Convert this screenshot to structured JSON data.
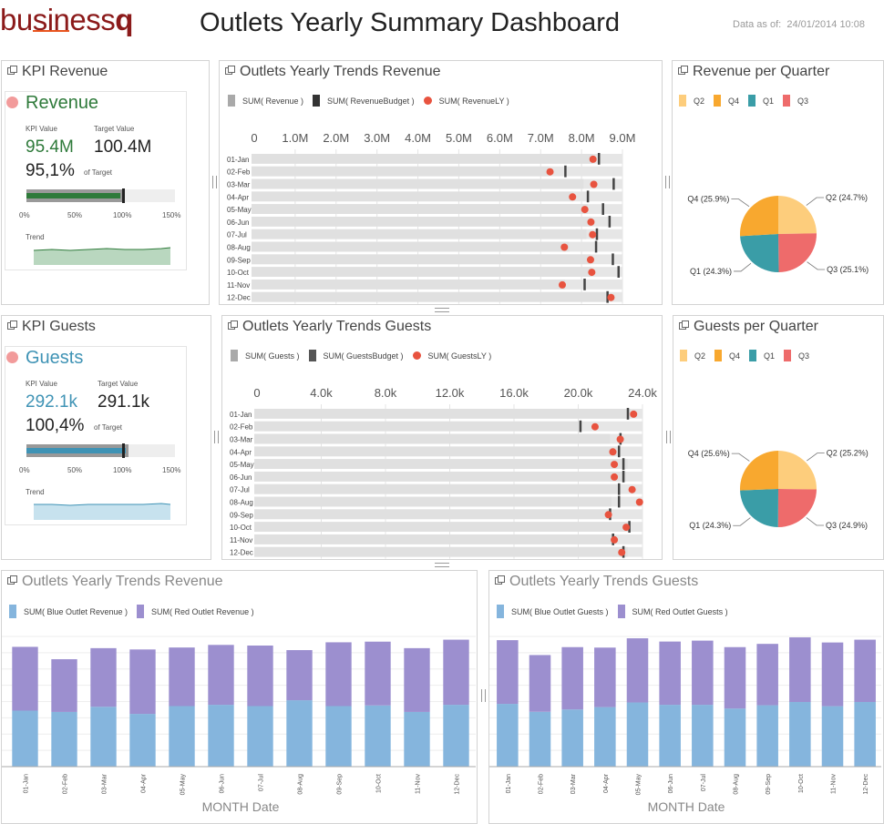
{
  "header": {
    "logo_prefix": "business",
    "logo_suffix": "q",
    "title": "Outlets Yearly Summary Dashboard",
    "data_as_of_label": "Data as of:",
    "data_as_of_value": "24/01/2014 10:08"
  },
  "colors": {
    "brand_dark": "#8b1a1a",
    "brand_accent": "#e8541e",
    "blue": "#85b5dd",
    "purple": "#9c8fcf",
    "gray_bar": "#e6e6e6",
    "actual_bar": "#a9a9a9",
    "budget_tick": "#444444",
    "ly_dot": "#e8533f",
    "green_value": "#2e7a3a",
    "teal_value": "#3f93b5",
    "q1": "#3a9da7",
    "q2": "#fdcd7c",
    "q3": "#ee6b6b",
    "q4": "#f8a82f"
  },
  "kpi_revenue": {
    "panel_title": "KPI Revenue",
    "name": "Revenue",
    "kpi_value_label": "KPI Value",
    "target_value_label": "Target Value",
    "kpi_value": "95.4M",
    "target_value": "100.4M",
    "percent": "95,1%",
    "of_target": "of Target",
    "progress_fraction": 0.951,
    "scale_labels": [
      "0%",
      "50%",
      "100%",
      "150%"
    ],
    "trend_label": "Trend"
  },
  "kpi_guests": {
    "panel_title": "KPI Guests",
    "name": "Guests",
    "kpi_value_label": "KPI Value",
    "target_value_label": "Target Value",
    "kpi_value": "292.1k",
    "target_value": "291.1k",
    "percent": "100,4%",
    "of_target": "of Target",
    "progress_fraction": 1.004,
    "scale_labels": [
      "0%",
      "50%",
      "100%",
      "150%"
    ],
    "trend_label": "Trend"
  },
  "trends_revenue": {
    "panel_title": "Outlets Yearly Trends Revenue",
    "legend": [
      "SUM( Revenue )",
      "SUM( RevenueBudget )",
      "SUM( RevenueLY )"
    ]
  },
  "trends_guests": {
    "panel_title": "Outlets Yearly Trends Guests",
    "legend": [
      "SUM( Guests )",
      "SUM( GuestsBudget )",
      "SUM( GuestsLY )"
    ]
  },
  "quarter_revenue": {
    "panel_title": "Revenue per Quarter",
    "legend": [
      "Q2",
      "Q4",
      "Q1",
      "Q3"
    ]
  },
  "quarter_guests": {
    "panel_title": "Guests per Quarter",
    "legend": [
      "Q2",
      "Q4",
      "Q1",
      "Q3"
    ]
  },
  "stacked_revenue": {
    "panel_title": "Outlets Yearly Trends Revenue",
    "legend": [
      "SUM( Blue Outlet Revenue )",
      "SUM( Red Outlet Revenue )"
    ]
  },
  "stacked_guests": {
    "panel_title": "Outlets Yearly Trends Guests",
    "legend": [
      "SUM( Blue Outlet Guests )",
      "SUM( Red Outlet Guests )"
    ]
  },
  "chart_data": [
    {
      "id": "bullet-revenue",
      "type": "bar",
      "categories": [
        "01-Jan",
        "02-Feb",
        "03-Mar",
        "04-Apr",
        "05-May",
        "06-Jun",
        "07-Jul",
        "08-Aug",
        "09-Sep",
        "10-Oct",
        "11-Nov",
        "12-Dec"
      ],
      "x_ticks": [
        "0",
        "1.0M",
        "2.0M",
        "3.0M",
        "4.0M",
        "5.0M",
        "6.0M",
        "7.0M",
        "8.0M",
        "9.0M"
      ],
      "xlim": [
        0,
        9000000
      ],
      "series": [
        {
          "name": "SUM( Revenue )",
          "values": [
            8280000,
            7200000,
            8050000,
            7800000,
            8150000,
            8240000,
            8120000,
            7700000,
            8220000,
            8250000,
            7600000,
            8600000
          ]
        },
        {
          "name": "SUM( RevenueBudget )",
          "values": [
            8420000,
            7600000,
            8780000,
            8150000,
            8520000,
            8680000,
            8370000,
            8350000,
            8760000,
            8900000,
            8070000,
            8630000
          ]
        },
        {
          "name": "SUM( RevenueLY )",
          "values": [
            8280000,
            7230000,
            8300000,
            7780000,
            8080000,
            8230000,
            8270000,
            7580000,
            8220000,
            8250000,
            7530000,
            8720000
          ]
        }
      ]
    },
    {
      "id": "bullet-guests",
      "type": "bar",
      "categories": [
        "01-Jan",
        "02-Feb",
        "03-Mar",
        "04-Apr",
        "05-May",
        "06-Jun",
        "07-Jul",
        "08-Aug",
        "09-Sep",
        "10-Oct",
        "11-Nov",
        "12-Dec"
      ],
      "x_ticks": [
        "0",
        "4.0k",
        "8.0k",
        "12.0k",
        "16.0k",
        "20.0k",
        "24.0k"
      ],
      "xlim": [
        0,
        26000
      ],
      "series": [
        {
          "name": "SUM( Guests )",
          "values": [
            25200,
            21900,
            23800,
            24400,
            25000,
            24900,
            24300,
            23900,
            23700,
            25200,
            24100,
            25000
          ]
        },
        {
          "name": "SUM( GuestsBudget )",
          "values": [
            25000,
            21800,
            24500,
            24400,
            24700,
            24700,
            24400,
            24400,
            23800,
            25100,
            24000,
            24700
          ]
        },
        {
          "name": "SUM( GuestsLY )",
          "values": [
            25400,
            22800,
            24500,
            24000,
            24100,
            24100,
            25300,
            25800,
            23700,
            24900,
            24100,
            24600
          ]
        }
      ]
    },
    {
      "id": "pie-revenue",
      "type": "pie",
      "labels": [
        "Q2 (24.7%)",
        "Q3 (25.1%)",
        "Q1 (24.3%)",
        "Q4 (25.9%)"
      ],
      "values": [
        24.7,
        25.1,
        24.3,
        25.9
      ]
    },
    {
      "id": "pie-guests",
      "type": "pie",
      "labels": [
        "Q2 (25.2%)",
        "Q3 (24.9%)",
        "Q1 (24.3%)",
        "Q4 (25.6%)"
      ],
      "values": [
        25.2,
        24.9,
        24.3,
        25.6
      ]
    },
    {
      "id": "stacked-revenue",
      "type": "bar",
      "xlabel": "MONTH Date",
      "categories": [
        "01-Jan",
        "02-Feb",
        "03-Mar",
        "04-Apr",
        "05-May",
        "06-Jun",
        "07-Jul",
        "08-Aug",
        "09-Sep",
        "10-Oct",
        "11-Nov",
        "12-Dec"
      ],
      "ylim": [
        0,
        10000000
      ],
      "series": [
        {
          "name": "SUM( Blue Outlet Revenue )",
          "values": [
            4300000,
            4200000,
            4600000,
            4050000,
            4650000,
            4750000,
            4650000,
            5100000,
            4650000,
            4700000,
            4200000,
            4750000
          ]
        },
        {
          "name": "SUM( Red Outlet Revenue )",
          "values": [
            4900000,
            4050000,
            4500000,
            4950000,
            4500000,
            4600000,
            4650000,
            3850000,
            4900000,
            4900000,
            4900000,
            5000000
          ]
        }
      ]
    },
    {
      "id": "stacked-guests",
      "type": "bar",
      "xlabel": "MONTH Date",
      "categories": [
        "01-Jan",
        "02-Feb",
        "03-Mar",
        "04-Apr",
        "05-May",
        "06-Jun",
        "07-Jul",
        "08-Aug",
        "09-Sep",
        "10-Oct",
        "11-Nov",
        "12-Dec"
      ],
      "ylim": [
        0,
        28000
      ],
      "series": [
        {
          "name": "SUM( Blue Outlet Guests )",
          "values": [
            13500,
            11800,
            12300,
            12800,
            13800,
            13300,
            13300,
            12500,
            13200,
            13900,
            13000,
            13900
          ]
        },
        {
          "name": "SUM( Red Outlet Guests )",
          "values": [
            13700,
            12200,
            13400,
            12800,
            13800,
            13600,
            13800,
            13200,
            13200,
            13900,
            13700,
            13400
          ]
        }
      ]
    }
  ]
}
